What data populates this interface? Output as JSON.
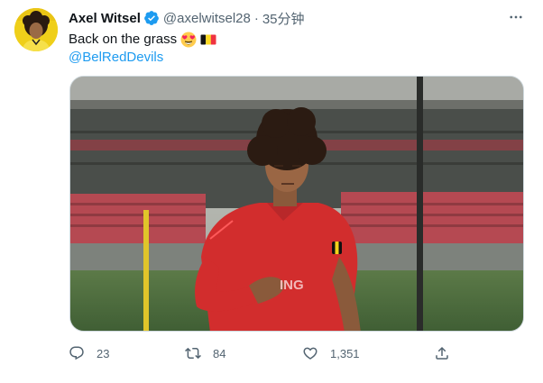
{
  "author": {
    "display_name": "Axel Witsel",
    "handle": "@axelwitsel28",
    "time": "35分钟",
    "verified": true
  },
  "tweet": {
    "text": "Back on the grass",
    "emojis": [
      "heart-eyes-emoji",
      "belgium-flag-emoji"
    ],
    "mention": "@BelRedDevils"
  },
  "actions": {
    "reply_count": "23",
    "retweet_count": "84",
    "like_count": "1,351"
  },
  "media": {
    "jersey_text": "ING"
  },
  "colors": {
    "accent": "#1d9bf0",
    "secondary_text": "#536471",
    "jersey": "#d22d2d"
  }
}
